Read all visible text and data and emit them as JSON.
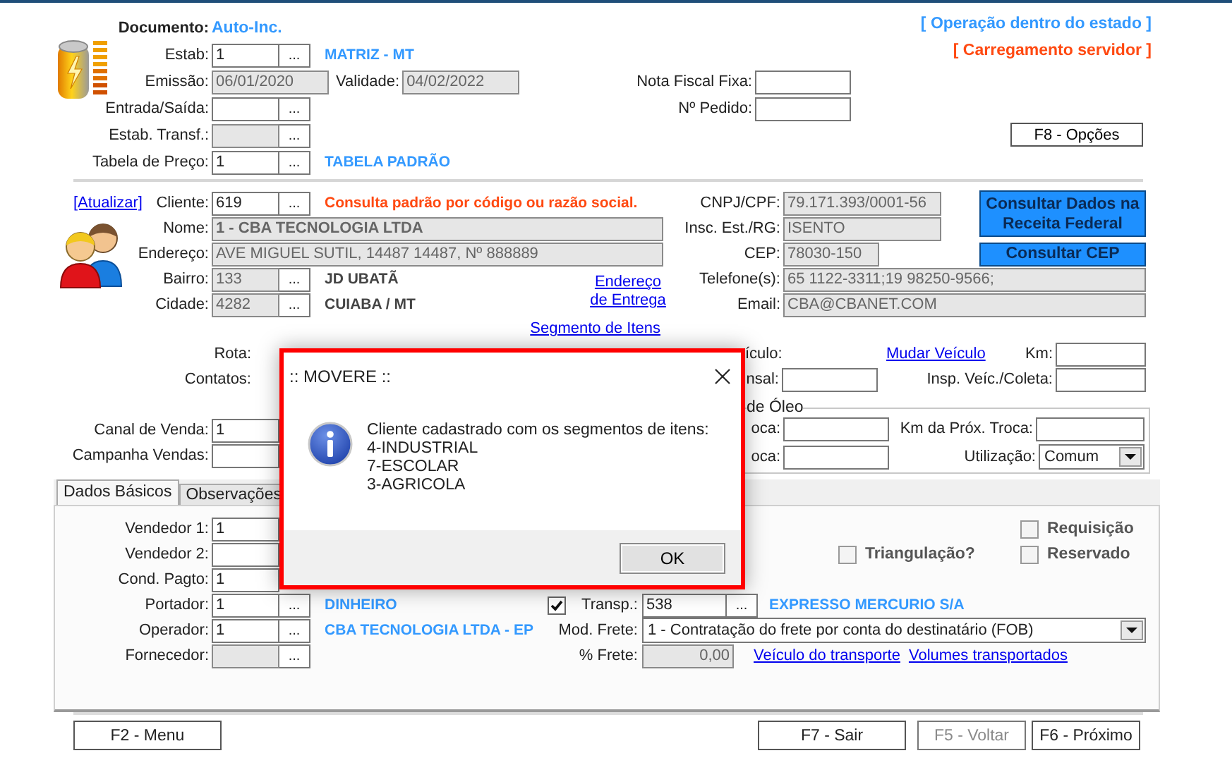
{
  "header": {
    "document": {
      "label": "Documento:",
      "value": "Auto-Inc."
    },
    "status": [
      {
        "text": "[ Operação dentro do estado ]",
        "color": "#3399ff"
      },
      {
        "text": "[ Carregamento servidor ]",
        "color": "#ff4a12"
      }
    ],
    "fields": [
      {
        "label": "Estab:",
        "value": "1",
        "kind": "short",
        "lookup": "...",
        "disabled": false,
        "description": "MATRIZ - MT",
        "color": "#3399ff"
      },
      {
        "label": "Emissão:",
        "value": "06/01/2020",
        "kind": "date",
        "disabled": true,
        "extra": {
          "label": "Validade:",
          "value": "04/02/2022",
          "kind": "date",
          "disabled": true
        }
      },
      {
        "label": "Entrada/Saída:",
        "kind": "short",
        "lookup": "...",
        "disabled": false
      },
      {
        "label": "Estab. Transf.:",
        "kind": "short",
        "lookup": "...",
        "disabled": true
      },
      {
        "label": "Tabela de Preço:",
        "value": "1",
        "kind": "short",
        "lookup": "...",
        "disabled": false,
        "description": "TABELA PADRÃO",
        "color": "#3399ff"
      }
    ],
    "right_fields": [
      {
        "label": "Nota Fiscal Fixa:",
        "kind": "medium",
        "disabled": false
      },
      {
        "label": "Nº Pedido:",
        "kind": "medium",
        "disabled": false
      }
    ],
    "options_button": "F8 - Opções"
  },
  "client": {
    "refresh_link": "[Atualizar]",
    "fields": [
      {
        "label": "Cliente:",
        "value": "619",
        "kind": "short",
        "lookup": "...",
        "disabled": false,
        "description": "Consulta padrão por código ou razão social.",
        "color": "#ff4a12"
      },
      {
        "label": "Nome:",
        "value": "1 - CBA TECNOLOGIA LTDA",
        "kind": "title",
        "disabled": true
      },
      {
        "label": "Endereço:",
        "value": "AVE MIGUEL SUTIL, 14487 14487, Nº 888889",
        "kind": "wide",
        "disabled": true
      },
      {
        "label": "Bairro:",
        "value": "133",
        "kind": "short",
        "lookup": "...",
        "disabled": true,
        "description": "JD UBATÃ",
        "color": "#444444"
      },
      {
        "label": "Cidade:",
        "value": "4282",
        "kind": "short",
        "lookup": "...",
        "disabled": true,
        "description": "CUIABA / MT",
        "color": "#444444"
      }
    ],
    "delivery_link": "Endereço de Entrega",
    "segments_link": "Segmento de Itens",
    "right_fields": [
      {
        "label": "CNPJ/CPF:",
        "value": "79.171.393/0001-56",
        "kind": "long",
        "disabled": true
      },
      {
        "label": "Insc. Est./RG:",
        "value": "ISENTO",
        "kind": "long",
        "disabled": true
      },
      {
        "label": "CEP:",
        "value": "78030-150",
        "kind": "medium",
        "disabled": true
      },
      {
        "label": "Telefone(s):",
        "value": "65 1122-3311;19 98250-9566;",
        "kind": "full",
        "disabled": true
      },
      {
        "label": "Email:",
        "value": "CBA@CBANET.COM",
        "kind": "full",
        "disabled": true
      }
    ],
    "receita_button": "Consultar Dados na Receita Federal",
    "cep_button": "Consultar CEP"
  },
  "transport": {
    "left_labels": [
      "Rota:",
      "Contatos:"
    ],
    "left_fields": [
      {
        "label": "Canal de Venda:",
        "value": "1",
        "kind": "short",
        "disabled": false
      },
      {
        "label": "Campanha Vendas:",
        "kind": "short",
        "disabled": false
      }
    ],
    "vehicle_label": "ículo:",
    "vehicle_link": "Mudar Veículo",
    "km": {
      "label": "Km:",
      "kind": "km",
      "disabled": false
    },
    "row2_label": "nsal:",
    "row2_field": {
      "kind": "medium",
      "disabled": false
    },
    "inspection": {
      "label": "Insp. Veíc./Coleta:",
      "kind": "km",
      "disabled": false
    },
    "oil": {
      "legend": "de Óleo",
      "fields": [
        {
          "label": "oca:",
          "kind": "oil",
          "disabled": false
        },
        {
          "label": "oca:",
          "kind": "oil",
          "disabled": false
        }
      ],
      "next_km": {
        "label": "Km da Próx. Troca:",
        "kind": "oil2",
        "disabled": false
      },
      "usage": {
        "label": "Utilização:",
        "value": "Comum"
      }
    }
  },
  "tabs": [
    {
      "label": "Dados Básicos",
      "selected": true
    },
    {
      "label": "Observações",
      "selected": false
    }
  ],
  "basic": {
    "fields": [
      {
        "label": "Vendedor 1:",
        "value": "1",
        "kind": "short",
        "disabled": false
      },
      {
        "label": "Vendedor 2:",
        "kind": "short",
        "disabled": false
      },
      {
        "label": "Cond. Pagto:",
        "value": "1",
        "kind": "short",
        "disabled": false
      },
      {
        "label": "Portador:",
        "value": "1",
        "kind": "short",
        "lookup": "...",
        "disabled": false,
        "description": "DINHEIRO",
        "color": "#3399ff"
      },
      {
        "label": "Operador:",
        "value": "1",
        "kind": "short",
        "lookup": "...",
        "disabled": false,
        "description": "CBA TECNOLOGIA LTDA - EP",
        "color": "#3399ff"
      },
      {
        "label": "Fornecedor:",
        "kind": "short",
        "lookup": "...",
        "disabled": true
      }
    ],
    "checks": [
      {
        "label": "Requisição",
        "checked": false
      },
      {
        "label": "Triangulação?",
        "checked": false
      },
      {
        "label": "Reservado",
        "checked": false
      }
    ],
    "carrier": {
      "checked": true,
      "label": "Transp.:",
      "value": "538",
      "kind": "carrier",
      "lookup": "...",
      "disabled": false,
      "description": "EXPRESSO MERCURIO S/A",
      "color": "#3399ff"
    },
    "freight_mode": {
      "label": "Mod. Frete:",
      "value": "1 - Contratação do frete por conta do destinatário (FOB)"
    },
    "freight_pct": {
      "label": "% Frete:",
      "value": "0,00",
      "kind": "pct",
      "disabled": true
    },
    "links": [
      "Veículo do transporte",
      "Volumes transportados"
    ]
  },
  "footer": [
    {
      "label": "F2 - Menu",
      "disabled": false
    },
    {
      "label": "F7 - Sair",
      "disabled": false
    },
    {
      "label": "F5 - Voltar",
      "disabled": true
    },
    {
      "label": "F6 - Próximo",
      "disabled": false
    }
  ],
  "dialog": {
    "title": ":: MOVERE ::",
    "message": "Cliente cadastrado com os segmentos de itens:\n4-INDUSTRIAL\n7-ESCOLAR\n3-AGRICOLA",
    "button": "OK"
  }
}
